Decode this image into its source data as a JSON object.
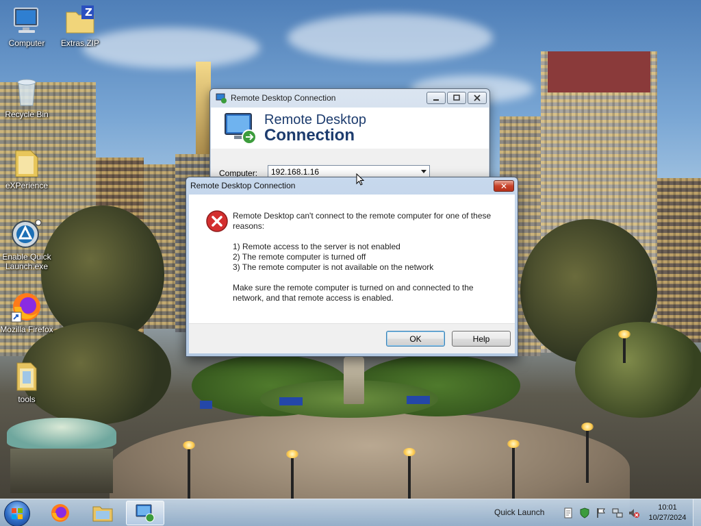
{
  "desktop": {
    "icons": [
      {
        "label": "Computer",
        "icon": "computer-icon"
      },
      {
        "label": "Extras.ZIP",
        "icon": "zip-folder-icon"
      },
      {
        "label": "Recycle Bin",
        "icon": "recycle-bin-icon"
      },
      {
        "label": "eXPerience",
        "icon": "folder-icon"
      },
      {
        "label": "Enable Quick Launch.exe",
        "icon": "quick-launch-app-icon"
      },
      {
        "label": "Mozilla Firefox",
        "icon": "firefox-icon"
      },
      {
        "label": "tools",
        "icon": "folder-icon"
      }
    ],
    "zip_letter": "Z"
  },
  "rdc_window": {
    "title": "Remote Desktop Connection",
    "banner_line1": "Remote Desktop",
    "banner_line2": "Connection",
    "computer_label": "Computer:",
    "computer_value": "192.168.1.16"
  },
  "error_dialog": {
    "title": "Remote Desktop Connection",
    "close_symbol": "✕",
    "intro": "Remote Desktop can't connect to the remote computer for one of these reasons:",
    "reasons": [
      "1) Remote access to the server is not enabled",
      "2) The remote computer is turned off",
      "3) The remote computer is not available on the network"
    ],
    "advice": "Make sure the remote computer is turned on and connected to the network, and that remote access is enabled.",
    "ok_label": "OK",
    "help_label": "Help"
  },
  "taskbar": {
    "apps": [
      "start-orb",
      "firefox-icon",
      "explorer-icon",
      "remote-desktop-icon"
    ],
    "quick_launch_label": "Quick Launch",
    "clock_time": "10:01",
    "clock_date": "10/27/2024"
  },
  "colors": {
    "banner_text": "#1d3c6e",
    "close_button": "#c8432b",
    "error_icon": "#d32f2f"
  }
}
